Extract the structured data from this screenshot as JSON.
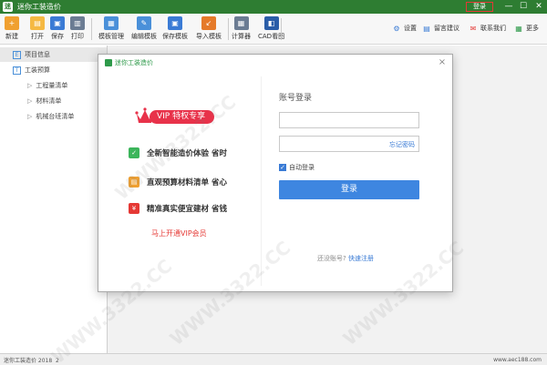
{
  "titlebar": {
    "app_icon": "迷",
    "title": "迷你工装造价",
    "login_label": "登录",
    "minimize": "—",
    "maximize": "☐",
    "close": "✕"
  },
  "toolbar": {
    "buttons": [
      {
        "label": "新建",
        "icon": "new-file-icon",
        "glyph": "+",
        "color": "#f0a030"
      },
      {
        "label": "打开",
        "icon": "open-folder-icon",
        "glyph": "▤",
        "color": "#f5b942"
      },
      {
        "label": "保存",
        "icon": "save-icon",
        "glyph": "▣",
        "color": "#3a7bd5"
      },
      {
        "label": "打印",
        "icon": "print-icon",
        "glyph": "▥",
        "color": "#6b7c93"
      },
      {
        "label": "模板管理",
        "icon": "template-manage-icon",
        "glyph": "▦",
        "color": "#4a90d9"
      },
      {
        "label": "编辑模板",
        "icon": "edit-template-icon",
        "glyph": "✎",
        "color": "#4a90d9"
      },
      {
        "label": "保存模板",
        "icon": "save-template-icon",
        "glyph": "▣",
        "color": "#3a7bd5"
      },
      {
        "label": "导入模板",
        "icon": "import-template-icon",
        "glyph": "↙",
        "color": "#e57a2a"
      },
      {
        "label": "计算器",
        "icon": "calculator-icon",
        "glyph": "▦",
        "color": "#6b7c93"
      },
      {
        "label": "CAD看图",
        "icon": "cad-viewer-icon",
        "glyph": "◧",
        "color": "#2a5da8"
      }
    ],
    "right": [
      {
        "label": "设置",
        "icon": "gear-icon",
        "glyph": "⚙",
        "color": "#3a7bd5"
      },
      {
        "label": "留言建议",
        "icon": "message-icon",
        "glyph": "▤",
        "color": "#3a7bd5"
      },
      {
        "label": "联系我们",
        "icon": "mail-icon",
        "glyph": "✉",
        "color": "#e53935"
      },
      {
        "label": "更多",
        "icon": "more-icon",
        "glyph": "▦",
        "color": "#2e9a4a"
      }
    ]
  },
  "sidebar": {
    "items": [
      {
        "label": "项目信息",
        "icon": "project-info-icon",
        "glyph": "E",
        "active": true
      },
      {
        "label": "工装预算",
        "icon": "budget-icon",
        "glyph": "T",
        "active": false
      },
      {
        "label": "工程量清单",
        "arrow": "▷"
      },
      {
        "label": "材料清单",
        "arrow": "▷"
      },
      {
        "label": "机械台班清单",
        "arrow": "▷"
      }
    ]
  },
  "statusbar": {
    "left": "迷你工装造价  2018  2",
    "right": "www.aec188.com"
  },
  "dialog": {
    "title": "迷你工装造价",
    "close": "×",
    "vip_pill": "VIP 特权专享",
    "vip_small": "V",
    "features": [
      {
        "text": "全新智能造价体验  省时",
        "icon": "leaf-icon",
        "glyph": "✓",
        "color": "#3cb55b"
      },
      {
        "text": "直观预算材料清单  省心",
        "icon": "list-icon",
        "glyph": "▤",
        "color": "#f0a030"
      },
      {
        "text": "精准真实便宜建材  省钱",
        "icon": "yen-icon",
        "glyph": "¥",
        "color": "#e53935"
      }
    ],
    "vip_link": "马上开通VIP会员",
    "login": {
      "title": "账号登录",
      "username_placeholder": "",
      "password_placeholder": "",
      "forgot": "忘记密码",
      "remember": "自动登录",
      "submit": "登录",
      "no_account": "还没账号?",
      "register": "快速注册"
    }
  },
  "watermark": "WWW.3322.CC"
}
